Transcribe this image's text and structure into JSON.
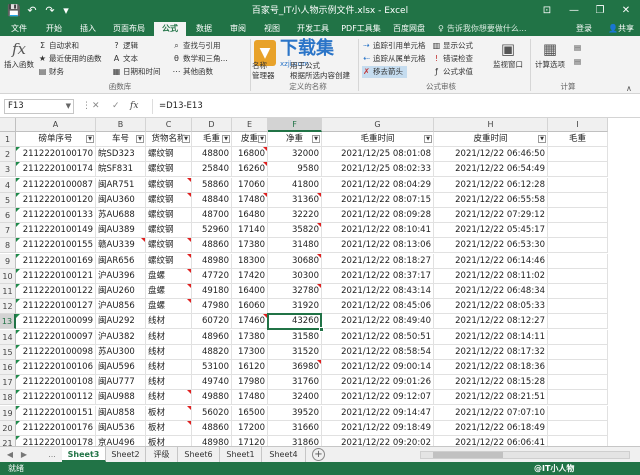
{
  "window": {
    "title": "百家号_IT小人物示例文件.xlsx - Excel",
    "quick_access": [
      "💾",
      "↶",
      "↷",
      "▾"
    ],
    "controls": [
      "⊡",
      "—",
      "❐",
      "✕"
    ]
  },
  "tabs": {
    "items": [
      "文件",
      "开始",
      "插入",
      "页面布局",
      "公式",
      "数据",
      "审阅",
      "视图",
      "开发工具",
      "PDF工具集",
      "百度网盘"
    ],
    "active_index": 4,
    "tell_me": "告诉我你想要做什么...",
    "login": "登录",
    "share": "共享"
  },
  "ribbon": {
    "insert_function": "插入函数",
    "autosum": "自动求和",
    "recent": "最近使用的函数",
    "financial": "财务",
    "logical": "逻辑",
    "text": "文本",
    "datetime": "日期和时间",
    "lookup": "查找与引用",
    "math": "数学和三角...",
    "more": "其他函数",
    "group_library": "函数库",
    "name_manager_a": "名称",
    "name_manager_b": "管理器",
    "define_name": "定义名称",
    "use_in_formula": "用于公式",
    "create_from_sel": "根据所选内容创建",
    "group_names": "定义的名称",
    "trace_prec": "追踪引用单元格",
    "trace_dep": "追踪从属单元格",
    "remove_arrows": "移去箭头",
    "show_formulas": "显示公式",
    "error_check": "错误检查",
    "eval_formula": "公式求值",
    "group_audit": "公式审核",
    "watch": "监视窗口",
    "calc_options": "计算选项",
    "group_calc": "计算",
    "watermark_title": "下载集",
    "watermark_sub": "xzji.com"
  },
  "formula_bar": {
    "name_box": "F13",
    "formula": "=D13-E13",
    "cancel": "✕",
    "enter": "✓",
    "fx": "fx"
  },
  "grid": {
    "columns": [
      "A",
      "B",
      "C",
      "D",
      "E",
      "F",
      "G",
      "H",
      "I"
    ],
    "selected_column": "F",
    "selected_row": 13,
    "header_row": [
      "磅单序号",
      "车号",
      "货物名称",
      "毛重",
      "皮重",
      "净重",
      "毛重时间",
      "皮重时间",
      "毛重"
    ],
    "rows": [
      [
        "2112220100170",
        "皖SD323",
        "螺纹钢",
        "48800",
        "16800",
        "32000",
        "2021/12/25 08:01:08",
        "2021/12/22 06:46:50",
        ""
      ],
      [
        "2112220100174",
        "皖SF831",
        "螺纹钢",
        "25840",
        "16260",
        "9580",
        "2021/12/25 08:02:33",
        "2021/12/22 06:54:49",
        ""
      ],
      [
        "2112220100087",
        "闽AR751",
        "螺纹钢",
        "58860",
        "17060",
        "41800",
        "2021/12/22 08:04:29",
        "2021/12/22 06:12:28",
        ""
      ],
      [
        "2112220100120",
        "闽AU360",
        "螺纹钢",
        "48840",
        "17480",
        "31360",
        "2021/12/22 08:07:15",
        "2021/12/22 06:55:58",
        ""
      ],
      [
        "2112220100133",
        "苏AU688",
        "螺纹钢",
        "48700",
        "16480",
        "32220",
        "2021/12/22 08:09:28",
        "2021/12/22 07:29:12",
        ""
      ],
      [
        "2112220100149",
        "闽AU389",
        "螺纹钢",
        "52960",
        "17140",
        "35820",
        "2021/12/22 08:10:41",
        "2021/12/22 05:45:17",
        ""
      ],
      [
        "2112220100155",
        "赣AU339",
        "螺纹钢",
        "48860",
        "17380",
        "31480",
        "2021/12/22 08:13:06",
        "2021/12/22 06:53:30",
        ""
      ],
      [
        "2112220100169",
        "闽AR656",
        "螺纹钢",
        "48980",
        "18300",
        "30680",
        "2021/12/22 08:18:27",
        "2021/12/22 06:14:46",
        ""
      ],
      [
        "2112220100121",
        "沪AU396",
        "盘螺",
        "47720",
        "17420",
        "30300",
        "2021/12/22 08:37:17",
        "2021/12/22 08:11:02",
        ""
      ],
      [
        "2112220100122",
        "闽AU260",
        "盘螺",
        "49180",
        "16400",
        "32780",
        "2021/12/22 08:43:14",
        "2021/12/22 06:48:34",
        ""
      ],
      [
        "2112220100127",
        "沪AU856",
        "盘螺",
        "47980",
        "16060",
        "31920",
        "2021/12/22 08:45:06",
        "2021/12/22 08:05:33",
        ""
      ],
      [
        "2112220100099",
        "闽AU292",
        "线材",
        "60720",
        "17460",
        "43260",
        "2021/12/22 08:49:40",
        "2021/12/22 08:12:27",
        ""
      ],
      [
        "2112220100097",
        "沪AU382",
        "线材",
        "48960",
        "17380",
        "31580",
        "2021/12/22 08:50:51",
        "2021/12/22 08:14:11",
        ""
      ],
      [
        "2112220100098",
        "苏AU300",
        "线材",
        "48820",
        "17300",
        "31520",
        "2021/12/22 08:58:54",
        "2021/12/22 08:17:32",
        ""
      ],
      [
        "2112220100106",
        "闽AU596",
        "线材",
        "53100",
        "16120",
        "36980",
        "2021/12/22 09:00:14",
        "2021/12/22 08:18:36",
        ""
      ],
      [
        "2112220100108",
        "闽AU777",
        "线材",
        "49740",
        "17980",
        "31760",
        "2021/12/22 09:01:26",
        "2021/12/22 08:15:28",
        ""
      ],
      [
        "2112220100112",
        "闽AU988",
        "线材",
        "49880",
        "17480",
        "32400",
        "2021/12/22 09:12:07",
        "2021/12/22 08:21:51",
        ""
      ],
      [
        "2112220100151",
        "闽AU858",
        "板材",
        "56020",
        "16500",
        "39520",
        "2021/12/22 09:14:47",
        "2021/12/22 07:07:10",
        ""
      ],
      [
        "2112220100176",
        "闽AU536",
        "板材",
        "48860",
        "17200",
        "31660",
        "2021/12/22 09:18:49",
        "2021/12/22 06:18:49",
        ""
      ],
      [
        "2112220100178",
        "京AU496",
        "板材",
        "48980",
        "17120",
        "31860",
        "2021/12/22 09:20:02",
        "2021/12/22 06:06:41",
        ""
      ]
    ]
  },
  "sheets": {
    "items": [
      "Sheet3",
      "Sheet2",
      "评级",
      "Sheet6",
      "Sheet1",
      "Sheet4"
    ],
    "active_index": 0,
    "add": "+",
    "nav_prev": "◀",
    "nav_next": "▶",
    "more": "..."
  },
  "status": {
    "ready": "就绪",
    "brand": "@IT小人物"
  },
  "colors": {
    "accent": "#217346",
    "comment_marker": "#e02020"
  }
}
